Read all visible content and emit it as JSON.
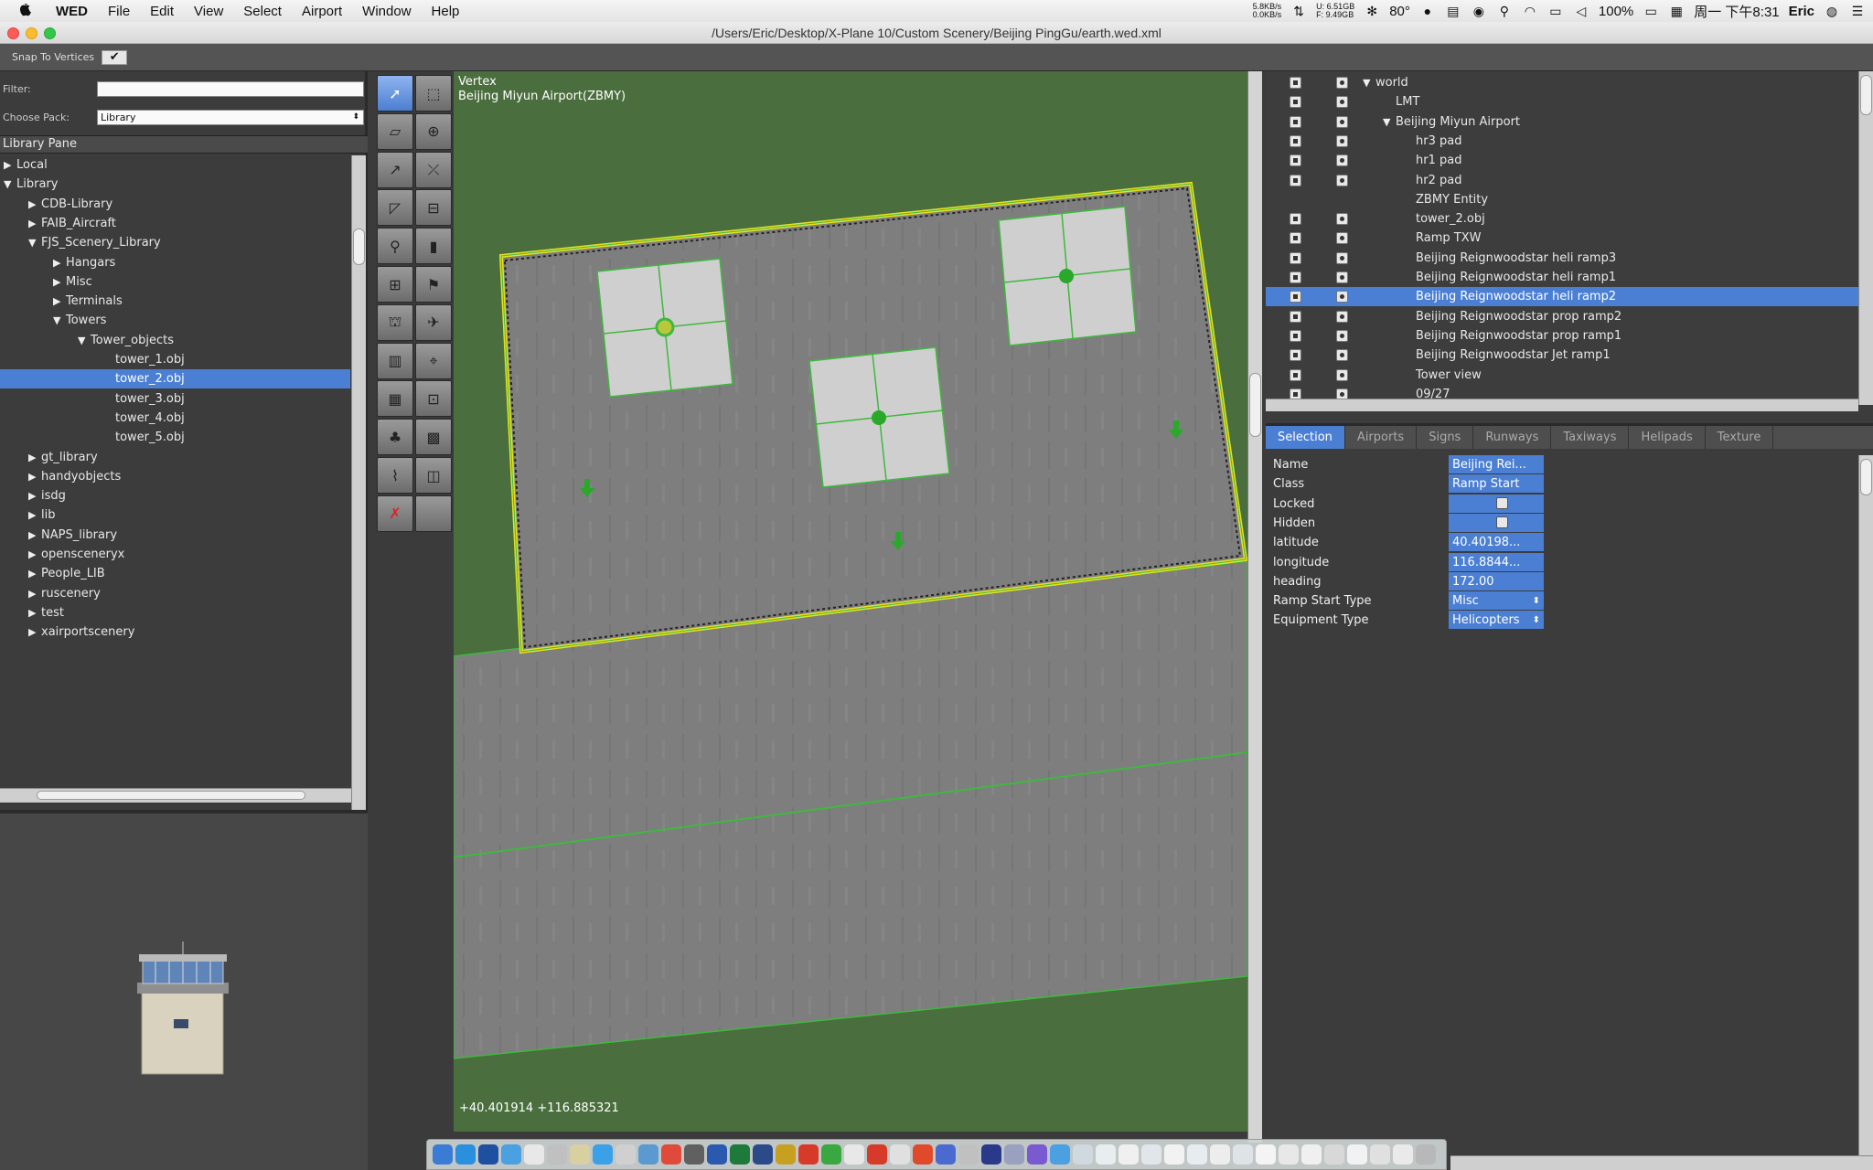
{
  "menubar": {
    "app": "WED",
    "menus": [
      "File",
      "Edit",
      "View",
      "Select",
      "Airport",
      "Window",
      "Help"
    ],
    "status": {
      "net_up": "5.8KB/s",
      "net_down": "0.0KB/s",
      "disk_u": "U: 6.51GB",
      "disk_f": "F: 9.49GB",
      "temp": "80°",
      "battery": "100%",
      "clock": "周一 下午8:31",
      "user": "Eric"
    }
  },
  "window": {
    "title": "/Users/Eric/Desktop/X-Plane 10/Custom Scenery/Beijing PingGu/earth.wed.xml"
  },
  "snap": {
    "label": "Snap To Vertices",
    "checked": "✔"
  },
  "library": {
    "filter_label": "Filter:",
    "filter_value": "",
    "pack_label": "Choose Pack:",
    "pack_value": "Library",
    "pane_title": "Library Pane",
    "tree": [
      {
        "label": "Local",
        "depth": 0,
        "expander": "▶",
        "selected": false
      },
      {
        "label": "Library",
        "depth": 0,
        "expander": "▼",
        "selected": false
      },
      {
        "label": "CDB-Library",
        "depth": 1,
        "expander": "▶",
        "selected": false
      },
      {
        "label": "FAIB_Aircraft",
        "depth": 1,
        "expander": "▶",
        "selected": false
      },
      {
        "label": "FJS_Scenery_Library",
        "depth": 1,
        "expander": "▼",
        "selected": false
      },
      {
        "label": "Hangars",
        "depth": 2,
        "expander": "▶",
        "selected": false
      },
      {
        "label": "Misc",
        "depth": 2,
        "expander": "▶",
        "selected": false
      },
      {
        "label": "Terminals",
        "depth": 2,
        "expander": "▶",
        "selected": false
      },
      {
        "label": "Towers",
        "depth": 2,
        "expander": "▼",
        "selected": false
      },
      {
        "label": "Tower_objects",
        "depth": 3,
        "expander": "▼",
        "selected": false
      },
      {
        "label": "tower_1.obj",
        "depth": 4,
        "expander": "",
        "selected": false
      },
      {
        "label": "tower_2.obj",
        "depth": 4,
        "expander": "",
        "selected": true
      },
      {
        "label": "tower_3.obj",
        "depth": 4,
        "expander": "",
        "selected": false
      },
      {
        "label": "tower_4.obj",
        "depth": 4,
        "expander": "",
        "selected": false
      },
      {
        "label": "tower_5.obj",
        "depth": 4,
        "expander": "",
        "selected": false
      },
      {
        "label": "gt_library",
        "depth": 1,
        "expander": "▶",
        "selected": false
      },
      {
        "label": "handyobjects",
        "depth": 1,
        "expander": "▶",
        "selected": false
      },
      {
        "label": "isdg",
        "depth": 1,
        "expander": "▶",
        "selected": false
      },
      {
        "label": "lib",
        "depth": 1,
        "expander": "▶",
        "selected": false
      },
      {
        "label": "NAPS_library",
        "depth": 1,
        "expander": "▶",
        "selected": false
      },
      {
        "label": "opensceneryx",
        "depth": 1,
        "expander": "▶",
        "selected": false
      },
      {
        "label": "People_LIB",
        "depth": 1,
        "expander": "▶",
        "selected": false
      },
      {
        "label": "ruscenery",
        "depth": 1,
        "expander": "▶",
        "selected": false
      },
      {
        "label": "test",
        "depth": 1,
        "expander": "▶",
        "selected": false
      },
      {
        "label": "xairportscenery",
        "depth": 1,
        "expander": "▶",
        "selected": false
      }
    ]
  },
  "tools": [
    "select-vertex-icon",
    "marquee-icon",
    "runway-icon",
    "helipad-icon",
    "sealane-icon",
    "taxiway-icon",
    "taxi-route-icon",
    "hold-line-icon",
    "ramp-start-icon",
    "sign-icon",
    "boundary-icon",
    "windsock-icon",
    "tower-view-icon",
    "airplane-icon",
    "facade-icon",
    "atc-icon",
    "object-icon",
    "polygon-icon",
    "tree-icon",
    "forest-icon",
    "line-icon",
    "string-icon",
    "delete-icon",
    "blank-icon"
  ],
  "map": {
    "mode": "Vertex",
    "airport": "Beijing Miyun Airport(ZBMY)",
    "coords": "+40.401914 +116.885321"
  },
  "hierarchy": [
    {
      "label": "world",
      "depth": 0,
      "expander": "▼",
      "lock": true,
      "eye": true,
      "selected": false
    },
    {
      "label": "LMT",
      "depth": 1,
      "expander": "",
      "lock": true,
      "eye": true,
      "selected": false
    },
    {
      "label": "Beijing Miyun Airport",
      "depth": 1,
      "expander": "▼",
      "lock": true,
      "eye": true,
      "selected": false
    },
    {
      "label": "hr3 pad",
      "depth": 2,
      "expander": "",
      "lock": true,
      "eye": true,
      "selected": false
    },
    {
      "label": "hr1 pad",
      "depth": 2,
      "expander": "",
      "lock": true,
      "eye": true,
      "selected": false
    },
    {
      "label": "hr2 pad",
      "depth": 2,
      "expander": "",
      "lock": true,
      "eye": true,
      "selected": false
    },
    {
      "label": "ZBMY Entity",
      "depth": 2,
      "expander": "",
      "lock": false,
      "eye": false,
      "selected": false
    },
    {
      "label": "tower_2.obj",
      "depth": 2,
      "expander": "",
      "lock": true,
      "eye": true,
      "selected": false
    },
    {
      "label": "Ramp TXW",
      "depth": 2,
      "expander": "",
      "lock": true,
      "eye": true,
      "selected": false
    },
    {
      "label": "Beijing Reignwoodstar heli ramp3",
      "depth": 2,
      "expander": "",
      "lock": true,
      "eye": true,
      "selected": false
    },
    {
      "label": "Beijing Reignwoodstar heli ramp1",
      "depth": 2,
      "expander": "",
      "lock": true,
      "eye": true,
      "selected": false
    },
    {
      "label": "Beijing Reignwoodstar heli ramp2",
      "depth": 2,
      "expander": "",
      "lock": true,
      "eye": true,
      "selected": true
    },
    {
      "label": "Beijing Reignwoodstar prop ramp2",
      "depth": 2,
      "expander": "",
      "lock": true,
      "eye": true,
      "selected": false
    },
    {
      "label": "Beijing Reignwoodstar prop ramp1",
      "depth": 2,
      "expander": "",
      "lock": true,
      "eye": true,
      "selected": false
    },
    {
      "label": "Beijing Reignwoodstar Jet ramp1",
      "depth": 2,
      "expander": "",
      "lock": true,
      "eye": true,
      "selected": false
    },
    {
      "label": "Tower view",
      "depth": 2,
      "expander": "",
      "lock": true,
      "eye": true,
      "selected": false
    },
    {
      "label": "09/27",
      "depth": 2,
      "expander": "",
      "lock": true,
      "eye": true,
      "selected": false
    }
  ],
  "tabs": [
    {
      "label": "Selection",
      "active": true
    },
    {
      "label": "Airports",
      "active": false
    },
    {
      "label": "Signs",
      "active": false
    },
    {
      "label": "Runways",
      "active": false
    },
    {
      "label": "Taxiways",
      "active": false
    },
    {
      "label": "Helipads",
      "active": false
    },
    {
      "label": "Texture",
      "active": false
    }
  ],
  "properties": [
    {
      "key": "Name",
      "value": "Beijing Rei...",
      "kind": "text"
    },
    {
      "key": "Class",
      "value": "Ramp Start",
      "kind": "text"
    },
    {
      "key": "Locked",
      "value": "",
      "kind": "lock"
    },
    {
      "key": "Hidden",
      "value": "",
      "kind": "eye"
    },
    {
      "key": "latitude",
      "value": " 40.40198...",
      "kind": "text"
    },
    {
      "key": "longitude",
      "value": " 116.8844...",
      "kind": "text"
    },
    {
      "key": "heading",
      "value": "172.00",
      "kind": "text"
    },
    {
      "key": "Ramp Start Type",
      "value": "Misc",
      "kind": "select"
    },
    {
      "key": "Equipment Type",
      "value": "Helicopters",
      "kind": "select"
    }
  ],
  "colors": {
    "selection": "#4a7fd4",
    "grass": "#4a6e3d",
    "outline_yellow": "#e8e020",
    "pad_green": "#2aa82a"
  }
}
